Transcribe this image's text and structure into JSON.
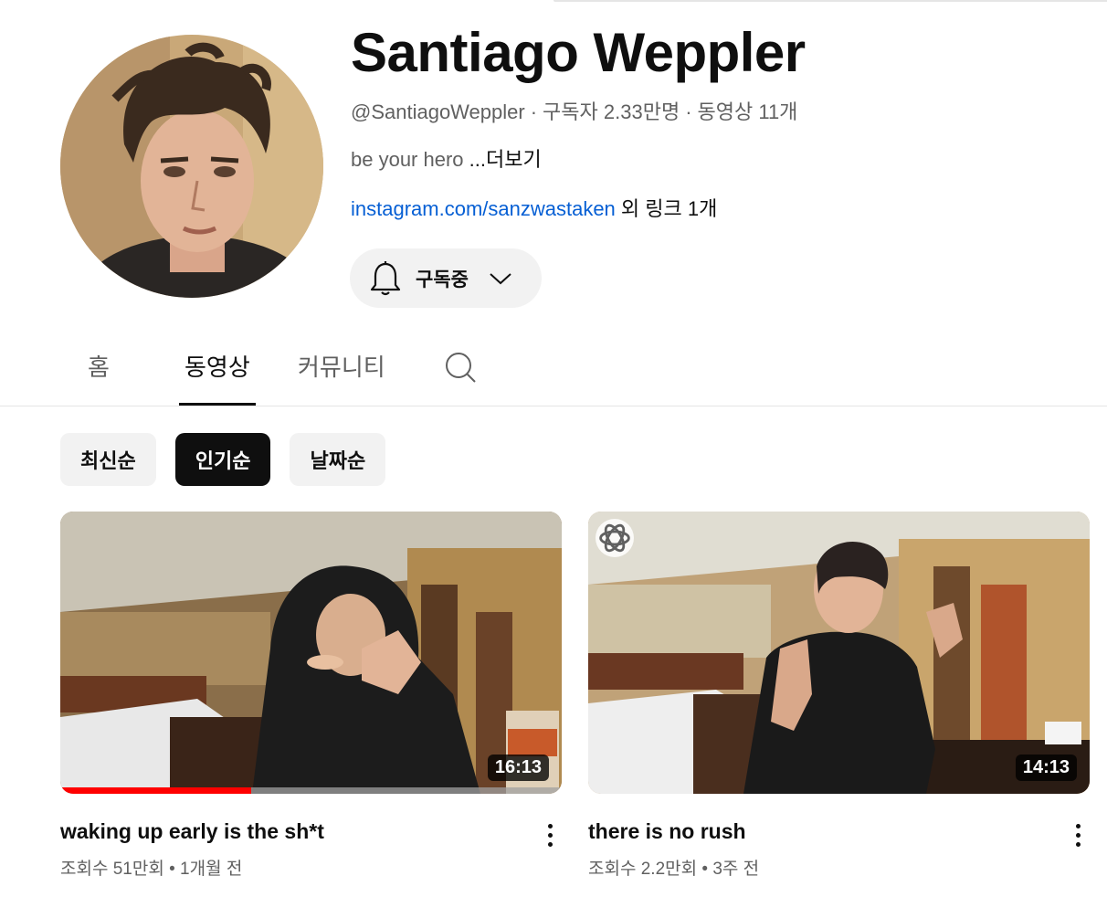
{
  "channel": {
    "name": "Santiago Weppler",
    "handle": "@SantiagoWeppler",
    "subscribers": "구독자 2.33만명",
    "video_count": "동영상 11개",
    "separator": "·",
    "description": "be your hero ",
    "more_label": "...더보기",
    "link_text": "instagram.com/sanzwastaken",
    "link_extra": " 외 링크 1개"
  },
  "subscribe": {
    "label": "구독중",
    "icon": "bell-icon"
  },
  "tabs": [
    {
      "label": "홈",
      "active": false
    },
    {
      "label": "동영상",
      "active": true
    },
    {
      "label": "커뮤니티",
      "active": false
    }
  ],
  "chips": [
    {
      "label": "최신순",
      "active": false
    },
    {
      "label": "인기순",
      "active": true
    },
    {
      "label": "날짜순",
      "active": false
    }
  ],
  "videos": [
    {
      "title": "waking up early is the sh*t",
      "views": "조회수 51만회",
      "age": "1개월 전",
      "separator": " • ",
      "duration": "16:13",
      "watch_progress": 0.38
    },
    {
      "title": "there is no rush",
      "views": "조회수 2.2만회",
      "age": "3주 전",
      "separator": " • ",
      "duration": "14:13",
      "overlay_icon": "openai-logo-icon"
    }
  ],
  "colors": {
    "link": "#065fd4",
    "progress": "#ff0000",
    "chip_active": "#0f0f0f",
    "chip_bg": "#f2f2f2"
  }
}
